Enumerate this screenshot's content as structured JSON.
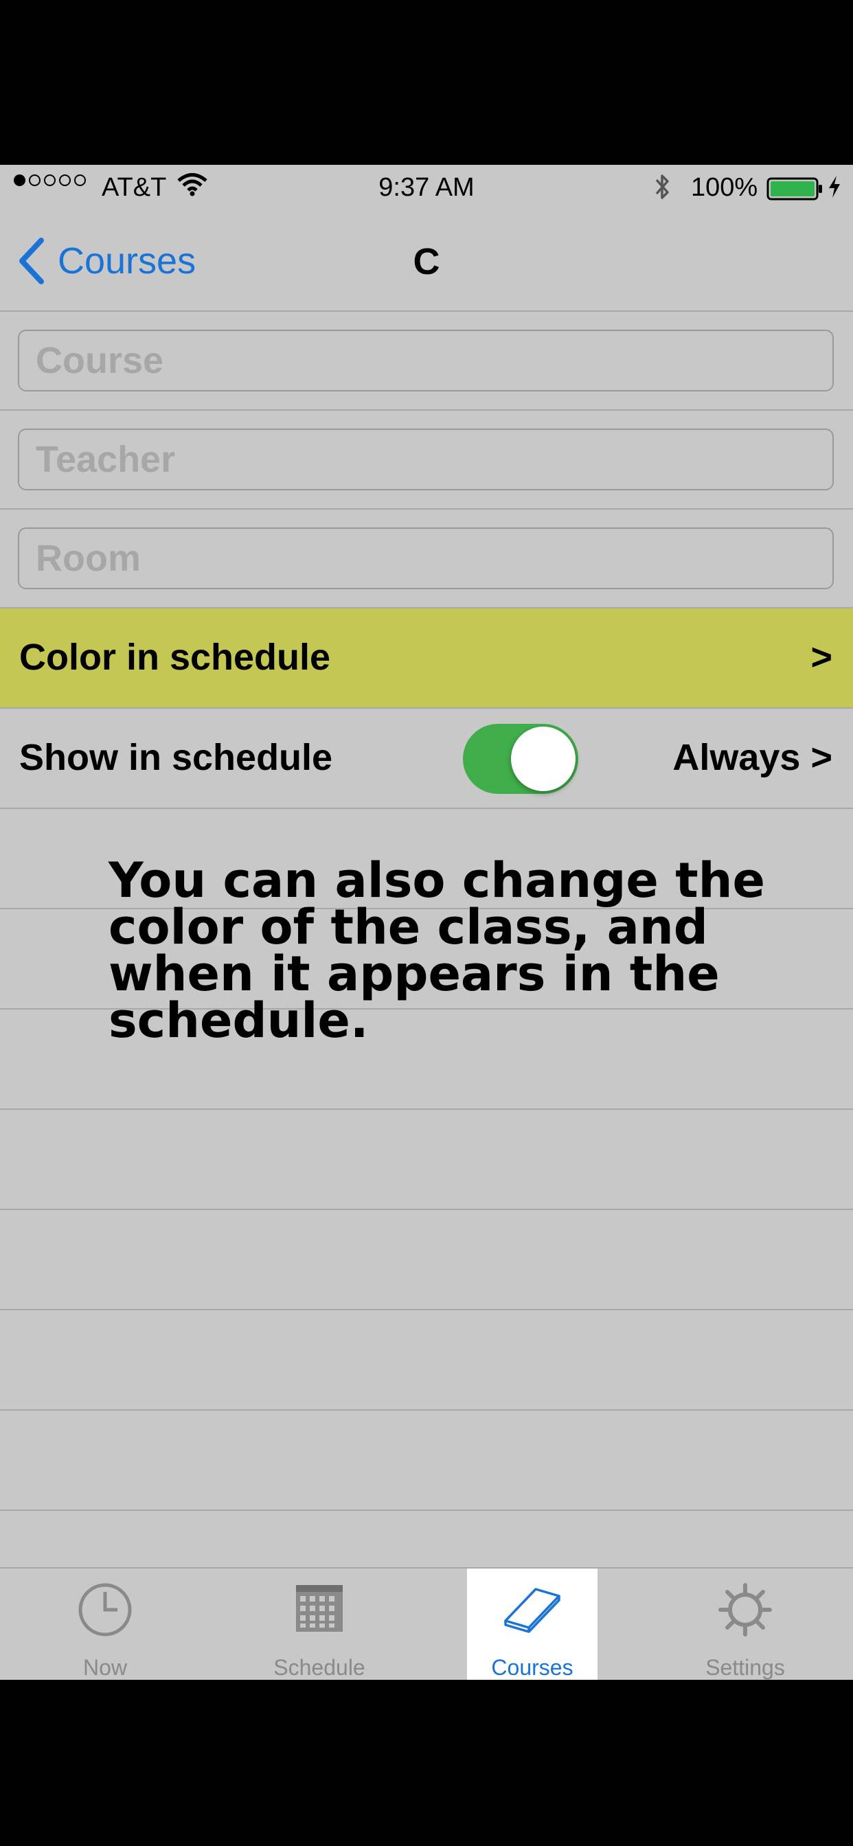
{
  "status_bar": {
    "carrier": "AT&T",
    "time": "9:37 AM",
    "battery": "100%"
  },
  "nav": {
    "back_label": "Courses",
    "title": "C"
  },
  "form": {
    "course_placeholder": "Course",
    "teacher_placeholder": "Teacher",
    "room_placeholder": "Room"
  },
  "color_row": {
    "label": "Color in schedule",
    "chevron": ">",
    "color": "#c5c754"
  },
  "show_row": {
    "label": "Show in schedule",
    "toggle_on": true,
    "value": "Always >"
  },
  "overlay": {
    "text": "You can also change the color of the class, and when it appears in the schedule."
  },
  "tabs": [
    {
      "label": "Now",
      "icon": "clock-icon"
    },
    {
      "label": "Schedule",
      "icon": "calendar-grid-icon"
    },
    {
      "label": "Courses",
      "icon": "book-icon",
      "active": true
    },
    {
      "label": "Settings",
      "icon": "gear-icon"
    }
  ],
  "colors": {
    "accent": "#1a74d8",
    "toggle": "#3fae4a",
    "background": "#c8c8c8"
  }
}
